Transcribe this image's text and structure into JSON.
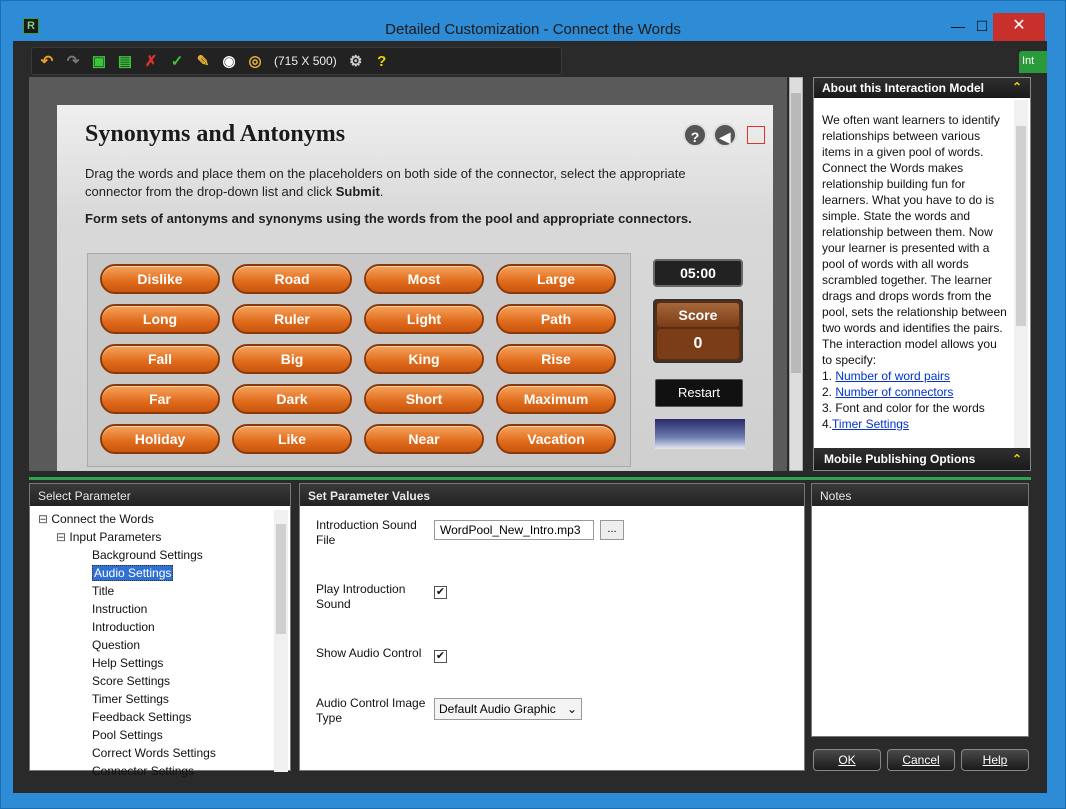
{
  "window": {
    "title": "Detailed Customization - Connect the Words",
    "app_icon": "R"
  },
  "toolbar": {
    "size_label": "(715 X 500)"
  },
  "side_tab": {
    "label": "Int"
  },
  "stage": {
    "title": "Synonyms and Antonyms",
    "instruction_plain": "Drag the words and place them on the placeholders on both side of the connector, select the appropriate connector from the drop-down list and click ",
    "instruction_bold": "Submit",
    "instruction_end": ".",
    "question": "Form sets of antonyms and synonyms using the words from the pool and appropriate connectors.",
    "words": [
      "Dislike",
      "Road",
      "Most",
      "Large",
      "Long",
      "Ruler",
      "Light",
      "Path",
      "Fall",
      "Big",
      "King",
      "Rise",
      "Far",
      "Dark",
      "Short",
      "Maximum",
      "Holiday",
      "Like",
      "Near",
      "Vacation"
    ],
    "timer": "05:00",
    "score_label": "Score",
    "score_value": "0",
    "restart_label": "Restart",
    "help_icon": "?",
    "audio_icon": "◀"
  },
  "about": {
    "header": "About this Interaction Model",
    "text": "We often want learners to identify relationships between various items in a given pool of words. Connect the Words makes relationship building fun for learners. What you have to do is simple. State the words and relationship between them. Now your learner is presented with a pool of words with all words scrambled together. The learner drags and drops words from the pool, sets the relationship between two words and identifies the pairs. The interaction model allows you to specify:",
    "items": [
      {
        "num": "1. ",
        "text": "Number of word pairs",
        "link": true
      },
      {
        "num": "2. ",
        "text": "Number of connectors",
        "link": true
      },
      {
        "num": "3. ",
        "text": "Font and color for the words",
        "link": false
      },
      {
        "num": "4.",
        "text": "Timer Settings",
        "link": true
      }
    ],
    "mobile_header": "Mobile Publishing Options"
  },
  "select_param": {
    "header": "Select Parameter",
    "root": "Connect the Words",
    "group": "Input Parameters",
    "items": [
      "Background Settings",
      "Audio Settings",
      "Title",
      "Instruction",
      "Introduction",
      "Question",
      "Help Settings",
      "Score Settings",
      "Timer Settings",
      "Feedback Settings",
      "Pool Settings",
      "Correct Words Settings",
      "Connector Settings"
    ],
    "selected_index": 1
  },
  "set_param": {
    "header": "Set Parameter Values",
    "intro_sound_label": "Introduction Sound File",
    "intro_sound_value": "WordPool_New_Intro.mp3",
    "browse_label": "...",
    "play_intro_label": "Play Introduction Sound",
    "show_audio_label": "Show Audio Control",
    "audio_image_label": "Audio Control Image Type",
    "audio_image_value": "Default Audio Graphic"
  },
  "notes": {
    "header": "Notes"
  },
  "buttons": {
    "ok": "OK",
    "cancel": "Cancel",
    "help": "Help"
  }
}
